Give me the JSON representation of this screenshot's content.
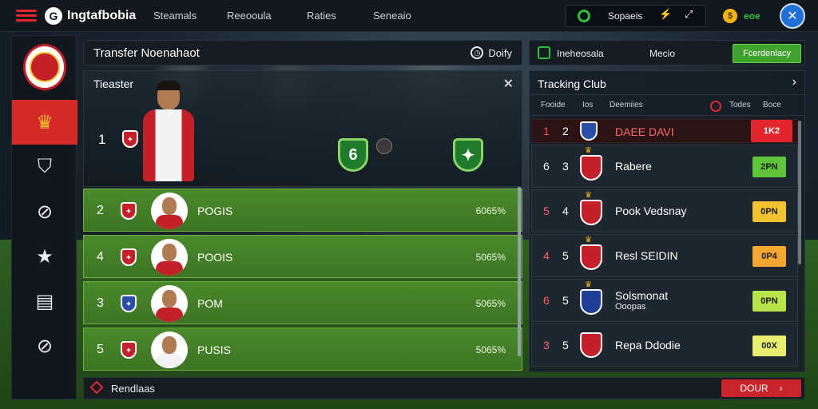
{
  "topbar": {
    "app_title": "Ingtafbobia",
    "nav": [
      "Steamals",
      "Reeooula",
      "Raties",
      "Seneaio"
    ],
    "search_label": "Sopaeis",
    "coin_text": "eoe"
  },
  "sidebar": {
    "items": [
      {
        "icon": "crown-icon",
        "active": true
      },
      {
        "icon": "shield-icon",
        "active": false
      },
      {
        "icon": "ball-icon",
        "active": false
      },
      {
        "icon": "star-icon",
        "active": false
      },
      {
        "icon": "newspaper-icon",
        "active": false
      },
      {
        "icon": "search-icon",
        "active": false
      }
    ]
  },
  "transfer": {
    "title": "Transfer  Noenahaot",
    "right_label": "Doify"
  },
  "featured": {
    "title": "Tieaster",
    "rank": "1"
  },
  "players": [
    {
      "rank": "2",
      "name": "POGIS",
      "value": "6065%"
    },
    {
      "rank": "4",
      "name": "POOIS",
      "value": "5065%"
    },
    {
      "rank": "3",
      "name": "POM",
      "value": "5065%"
    },
    {
      "rank": "5",
      "name": "PUSIS",
      "value": "5065%"
    }
  ],
  "tracking": {
    "header_left": "Ineheosala",
    "header_mid": "Mecio",
    "header_button": "Fcerdenlacy",
    "title": "Tracking Club",
    "cols": [
      "Fooide",
      "Ios",
      "Deemiies",
      "Todes",
      "Boce"
    ],
    "clubs": [
      {
        "pos1": "1",
        "pos2": "2",
        "name": "DAEE DAVI",
        "name2": "",
        "tag": "1K2",
        "pos_color": "#ff5050",
        "tag_color": "#e2262d"
      },
      {
        "pos1": "6",
        "pos2": "3",
        "name": "Rabere",
        "name2": "",
        "tag": "2PN",
        "pos_color": "#e8edf2",
        "tag_color": "#5fc43a"
      },
      {
        "pos1": "5",
        "pos2": "4",
        "name": "Pook Vedsnay",
        "name2": "",
        "tag": "0PN",
        "pos_color": "#ff6060",
        "tag_color": "#f2c230"
      },
      {
        "pos1": "4",
        "pos2": "5",
        "name": "Resl SEIDIN",
        "name2": "",
        "tag": "0P4",
        "pos_color": "#ff6060",
        "tag_color": "#f2a830"
      },
      {
        "pos1": "6",
        "pos2": "5",
        "name": "Solsmonat",
        "name2": "Ooopas",
        "tag": "0PN",
        "pos_color": "#ff6060",
        "tag_color": "#b8e34a"
      },
      {
        "pos1": "3",
        "pos2": "5",
        "name": "Repa Ddodie",
        "name2": "",
        "tag": "00X",
        "pos_color": "#ff6060",
        "tag_color": "#e8ef70"
      }
    ]
  },
  "bottom": {
    "label": "Rendlaas",
    "button": "DOUR"
  }
}
